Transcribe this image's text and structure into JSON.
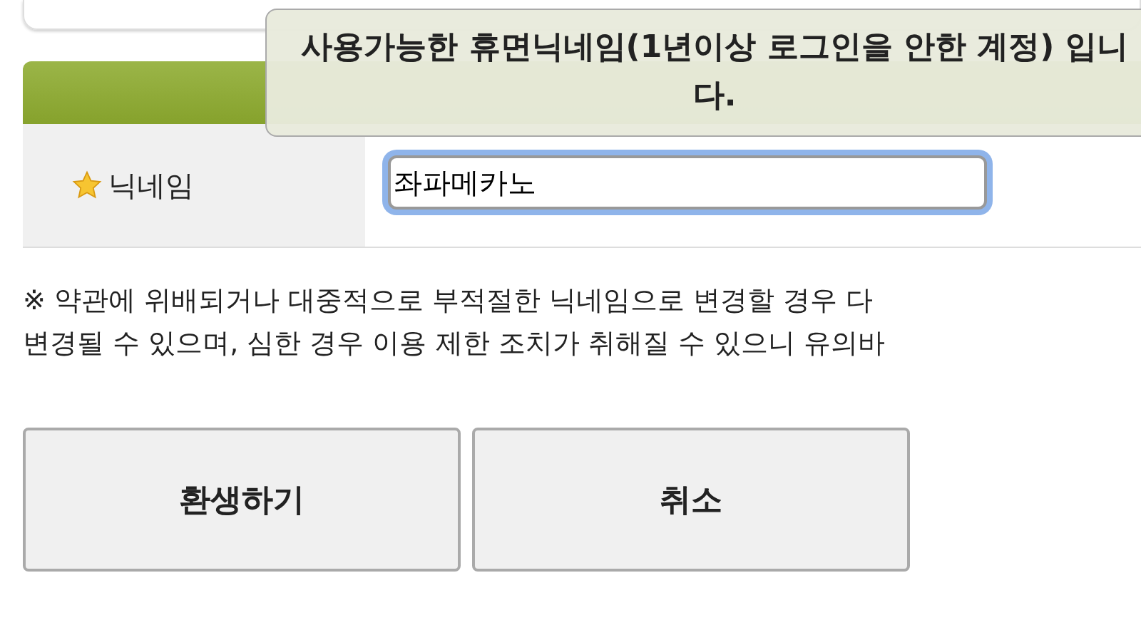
{
  "tooltip": {
    "text": "사용가능한 휴면닉네임(1년이상 로그인을 안한 계정) 입니다."
  },
  "form": {
    "label": "닉네임",
    "value": "좌파메카노",
    "focused": true
  },
  "notice": [
    "※ 약관에 위배되거나 대중적으로 부적절한 닉네임으로 변경할 경우 다",
    "변경될 수 있으며, 심한 경우 이용 제한 조치가 취해질 수 있으니 유의바"
  ],
  "buttons": [
    "환생하기",
    "취소"
  ]
}
